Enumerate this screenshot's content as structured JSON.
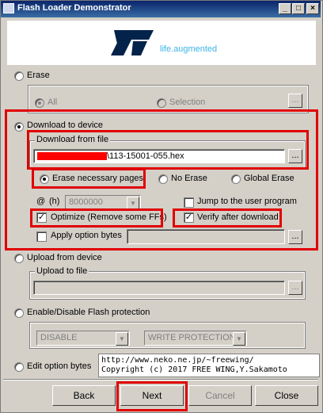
{
  "window": {
    "title": "Flash Loader Demonstrator"
  },
  "logo": {
    "tagline": "life.augmented"
  },
  "erase": {
    "label": "Erase",
    "all_label": "All",
    "selection_label": "Selection",
    "dots": "..."
  },
  "download": {
    "label": "Download to device",
    "group_label": "Download from file",
    "file_value": "\\113-15001-055.hex",
    "dots": "...",
    "erase_necessary_label": "Erase necessary pages",
    "no_erase_label": "No Erase",
    "global_erase_label": "Global Erase",
    "at_label": "@",
    "h_label": "(h)",
    "address_value": "8000000",
    "jump_label": "Jump to the user program",
    "optimize_label": "Optimize (Remove some FFs)",
    "verify_label": "Verify after download",
    "apply_option_label": "Apply option bytes"
  },
  "upload": {
    "label": "Upload from device",
    "group_label": "Upload to file",
    "dots": "..."
  },
  "protection": {
    "label": "Enable/Disable Flash protection",
    "state_value": "DISABLE",
    "type_value": "WRITE PROTECTION"
  },
  "option_bytes": {
    "label": "Edit option bytes"
  },
  "copyright": {
    "line1": "http://www.neko.ne.jp/~freewing/",
    "line2": "Copyright (c) 2017 FREE WING,Y.Sakamoto"
  },
  "buttons": {
    "back": "Back",
    "next": "Next",
    "cancel": "Cancel",
    "close": "Close"
  },
  "colors": {
    "highlight": "#e00000",
    "logo_blue": "#03234b",
    "tagline": "#3cb4e6",
    "redacted": "#ff0000"
  }
}
